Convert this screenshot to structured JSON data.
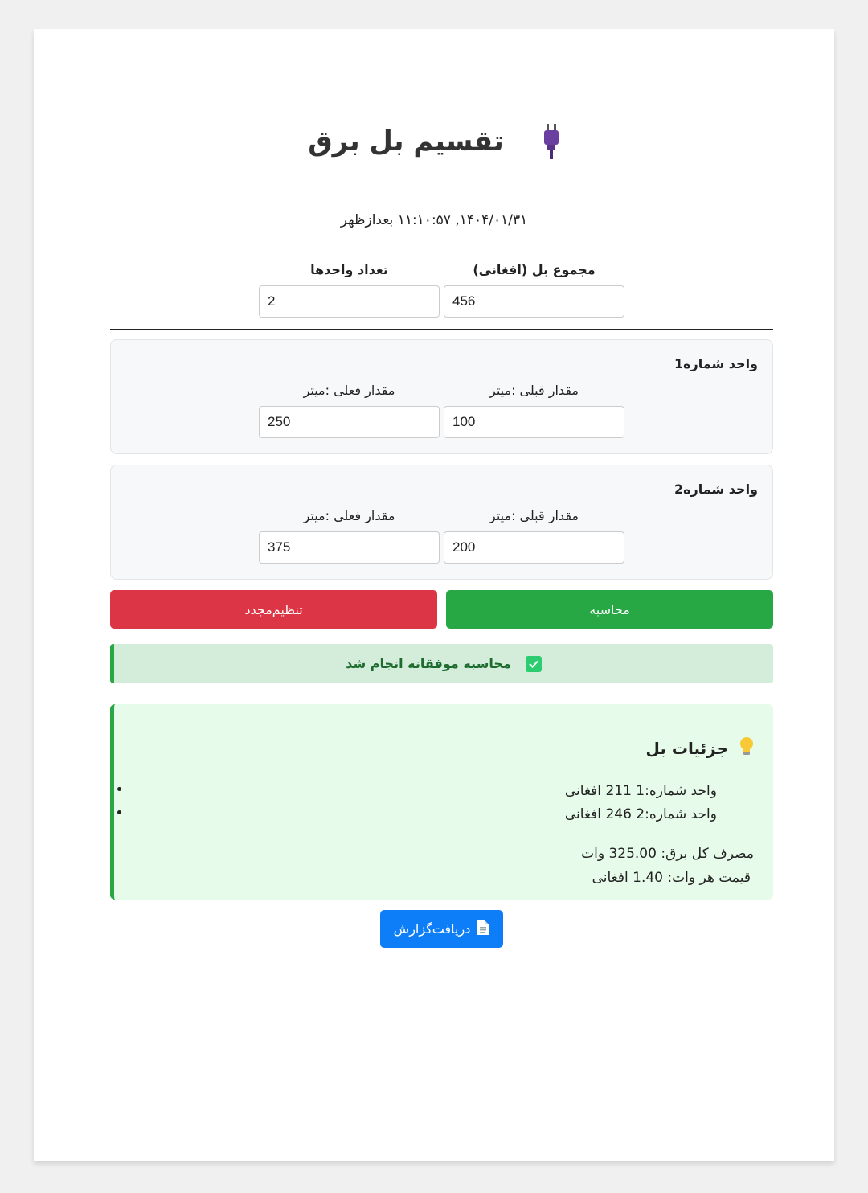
{
  "header": {
    "title": "تقسیم بل برق",
    "icon": "plug-icon",
    "datetime": "۱۴۰۴/۰۱/۳۱, ۱۱:۱۰:۵۷ بعدازظهر"
  },
  "totals": {
    "total_bill_label": "مجموع بل (افغانی)",
    "total_bill_value": "456",
    "units_count_label": "تعداد واحدها",
    "units_count_value": "2"
  },
  "units": [
    {
      "title": "واحد شماره1",
      "previous_label": "مقدار قبلی :میتر",
      "previous_value": "100",
      "current_label": "مقدار فعلی :میتر",
      "current_value": "250"
    },
    {
      "title": "واحد شماره2",
      "previous_label": "مقدار قبلی :میتر",
      "previous_value": "200",
      "current_label": "مقدار فعلی :میتر",
      "current_value": "375"
    }
  ],
  "buttons": {
    "calculate": "محاسبه",
    "reset": "تنظیم‌مجدد",
    "download": "دریافت‌گزارش"
  },
  "alert": {
    "message": "محاسبه موفقانه انجام شد",
    "icon": "checkmark-icon"
  },
  "details": {
    "title": "جزئیات بل",
    "icon": "lightbulb-icon",
    "unit1": "واحد شماره:1 211 افغانی",
    "unit2": "واحد شماره:2 246 افغانی",
    "total_consumption": "مصرف کل برق: 325.00 وات",
    "price_per_watt": "قیمت هر وات: 1.40 افغانی"
  },
  "colors": {
    "accent_green": "#28a745",
    "accent_red": "#dc3545",
    "accent_blue": "#0d7ef7",
    "success_bg": "#d4edda",
    "details_bg": "#e6fbe9"
  }
}
